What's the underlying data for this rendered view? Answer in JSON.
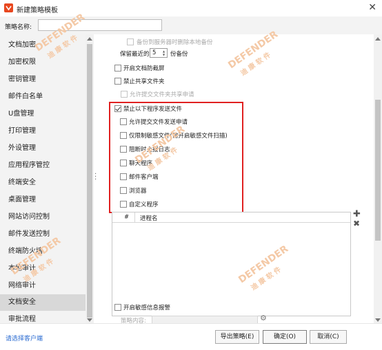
{
  "window": {
    "title": "新建策略模板"
  },
  "form": {
    "name_label": "策略名称:",
    "name_value": ""
  },
  "sidebar": {
    "active": "文档安全",
    "items": [
      "文档加密",
      "加密权限",
      "密钥管理",
      "邮件白名单",
      "U盘管理",
      "打印管理",
      "外设管理",
      "应用程序管控",
      "终端安全",
      "桌面管理",
      "网站访问控制",
      "邮件发送控制",
      "终端防火墙",
      "本地审计",
      "网络审计",
      "文档安全",
      "审批流程"
    ]
  },
  "content": {
    "backup_delete": {
      "label": "备份到服务器时删除本地备份",
      "checked": false,
      "enabled": false
    },
    "keep_recent": {
      "prefix": "保留最近的",
      "value": "5",
      "suffix": "份备份"
    },
    "anti_screenshot": {
      "label": "开启文档防截屏",
      "checked": false
    },
    "block_shared": {
      "label": "禁止共享文件夹",
      "checked": false
    },
    "allow_shared_request": {
      "label": "允许提交文件夹共享申请",
      "checked": false,
      "enabled": false
    },
    "block_programs": {
      "label": "禁止以下程序发送文件",
      "checked": true
    },
    "sub_options": [
      {
        "label": "允许提交文件发送申请",
        "checked": false
      },
      {
        "label": "仅限制敏感文件(需开启敏感文件扫描)",
        "checked": false
      },
      {
        "label": "阻断时上报日志",
        "checked": false
      },
      {
        "label": "聊天程序",
        "checked": false
      },
      {
        "label": "邮件客户端",
        "checked": false
      },
      {
        "label": "浏览器",
        "checked": false
      },
      {
        "label": "自定义程序",
        "checked": false
      }
    ],
    "table": {
      "col_index": "#",
      "col_name": "进程名"
    },
    "sensitive_alert": {
      "label": "开启敏感信息报警",
      "checked": false
    },
    "policy_content_label": "策略内容:"
  },
  "footer": {
    "client_link": "请选择客户端",
    "export_label": "导出策略(E)",
    "ok_label": "确定(O)",
    "cancel_label": "取消(C)"
  },
  "watermark": {
    "brand": "DEFENDER",
    "cn": "迪 康 软 件",
    "color": "#f4c9a6"
  },
  "colors": {
    "highlight_border": "#e02020",
    "link": "#2a6bd1",
    "active_item": "#d8d8d8"
  }
}
